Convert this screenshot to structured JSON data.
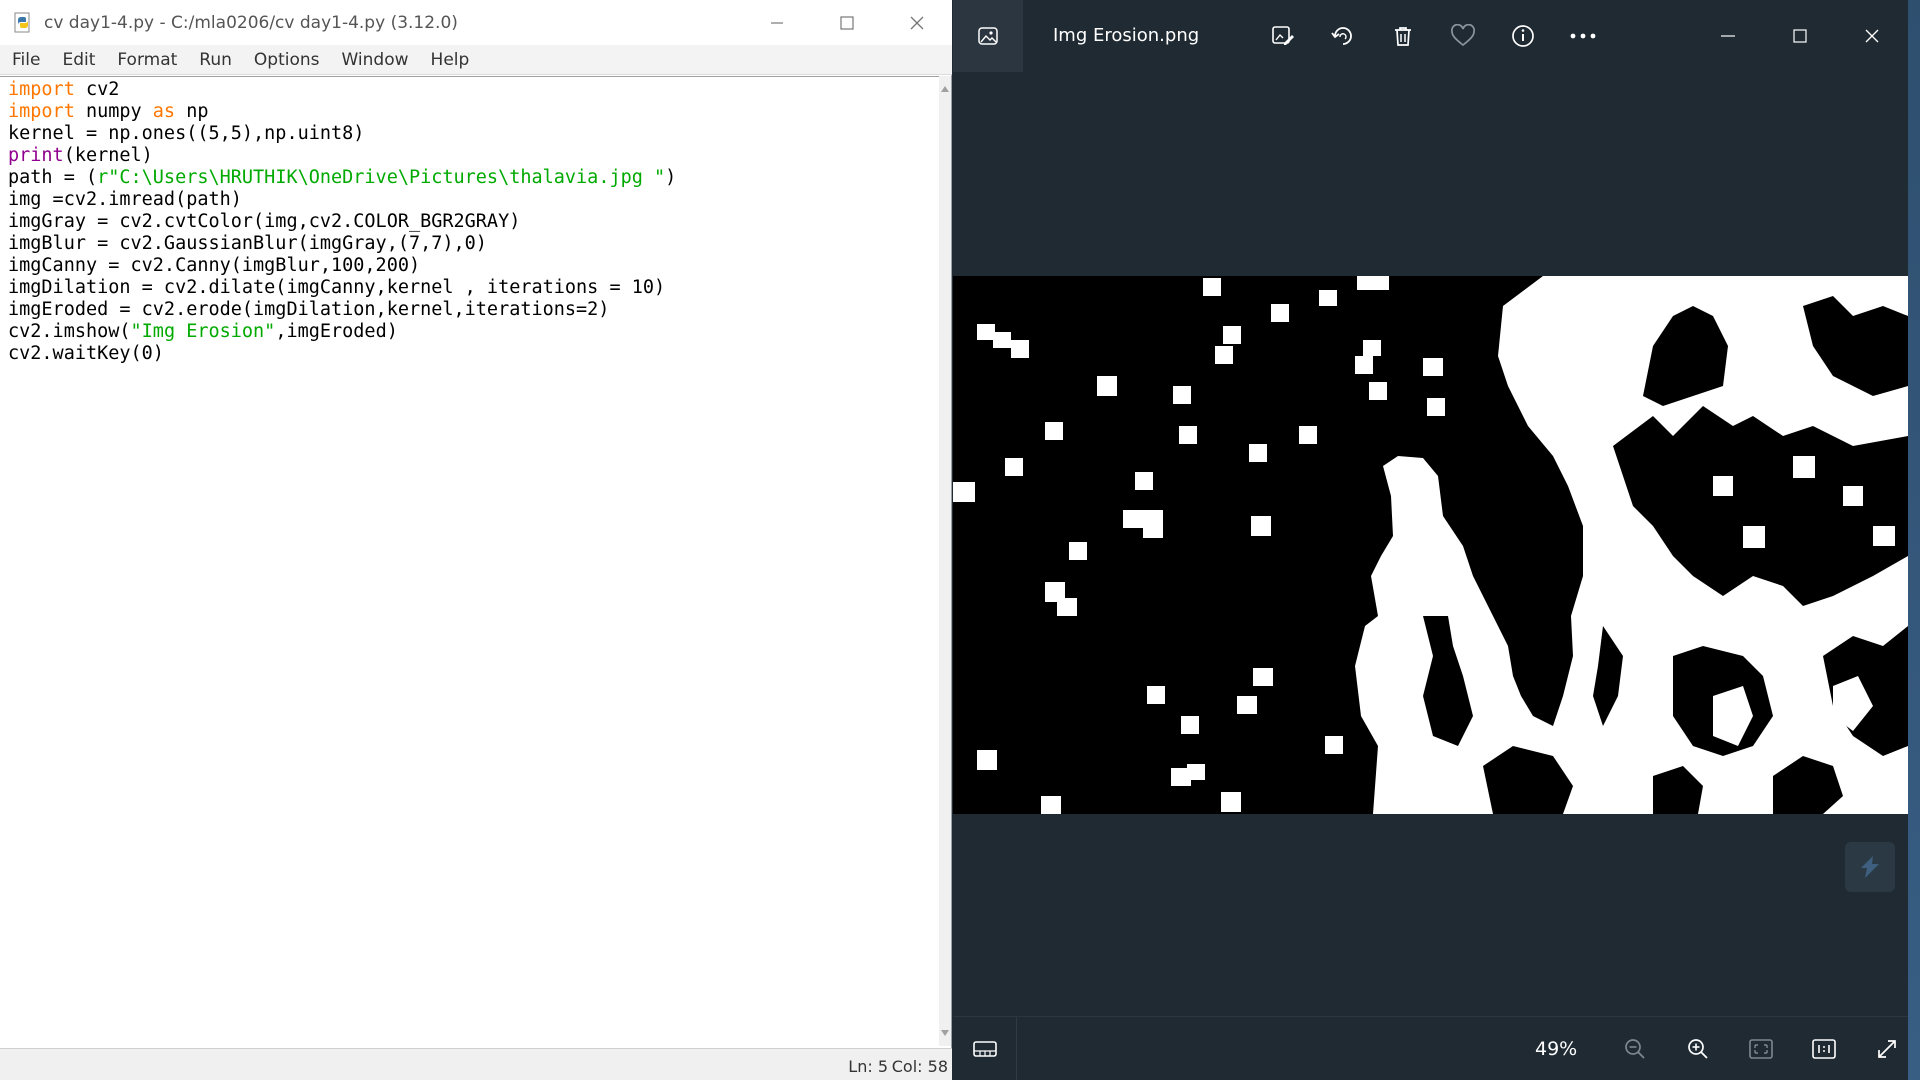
{
  "idle": {
    "title": "cv day1-4.py - C:/mla0206/cv day1-4.py (3.12.0)",
    "menu": [
      "File",
      "Edit",
      "Format",
      "Run",
      "Options",
      "Window",
      "Help"
    ],
    "code": [
      [
        {
          "t": "import",
          "c": "kw"
        },
        {
          "t": " cv2",
          "c": ""
        }
      ],
      [
        {
          "t": "import",
          "c": "kw"
        },
        {
          "t": " numpy ",
          "c": ""
        },
        {
          "t": "as",
          "c": "kw"
        },
        {
          "t": " np",
          "c": ""
        }
      ],
      [
        {
          "t": "kernel = np.ones((5,5),np.uint8)",
          "c": ""
        }
      ],
      [
        {
          "t": "print",
          "c": "bi"
        },
        {
          "t": "(kernel)",
          "c": ""
        }
      ],
      [
        {
          "t": "path = (",
          "c": ""
        },
        {
          "t": "r\"C:\\Users\\HRUTHIK\\OneDrive\\Pictures\\thalavia.jpg \"",
          "c": "str"
        },
        {
          "t": ")",
          "c": ""
        }
      ],
      [
        {
          "t": "img =cv2.imread(path)",
          "c": ""
        }
      ],
      [
        {
          "t": "imgGray = cv2.cvtColor(img,cv2.COLOR_BGR2GRAY)",
          "c": ""
        }
      ],
      [
        {
          "t": "imgBlur = cv2.GaussianBlur(imgGray,(7,7),0)",
          "c": ""
        }
      ],
      [
        {
          "t": "imgCanny = cv2.Canny(imgBlur,100,200)",
          "c": ""
        }
      ],
      [
        {
          "t": "imgDilation = cv2.dilate(imgCanny,kernel , iterations = 10)",
          "c": ""
        }
      ],
      [
        {
          "t": "imgEroded = cv2.erode(imgDilation,kernel,iterations=2)",
          "c": ""
        }
      ],
      [
        {
          "t": "cv2.imshow(",
          "c": ""
        },
        {
          "t": "\"Img Erosion\"",
          "c": "str"
        },
        {
          "t": ",imgEroded)",
          "c": ""
        }
      ],
      [
        {
          "t": "cv2.waitKey(0)",
          "c": ""
        }
      ]
    ],
    "status": {
      "ln": "Ln: 5",
      "col": "Col: 58"
    }
  },
  "photos": {
    "title": "Img Erosion.png",
    "zoom": "49%",
    "tool_icons": [
      "edit-image-icon",
      "rotate-icon",
      "delete-icon",
      "favorite-icon",
      "info-icon",
      "more-icon"
    ],
    "bottom_icons": [
      "zoom-out-icon",
      "zoom-in-icon",
      "fit-window-icon",
      "actual-size-icon",
      "fullscreen-icon"
    ]
  },
  "colors": {
    "keyword": "#ff7700",
    "builtin": "#900090",
    "string": "#00aa00",
    "viewer_bg": "#1f2a33"
  }
}
